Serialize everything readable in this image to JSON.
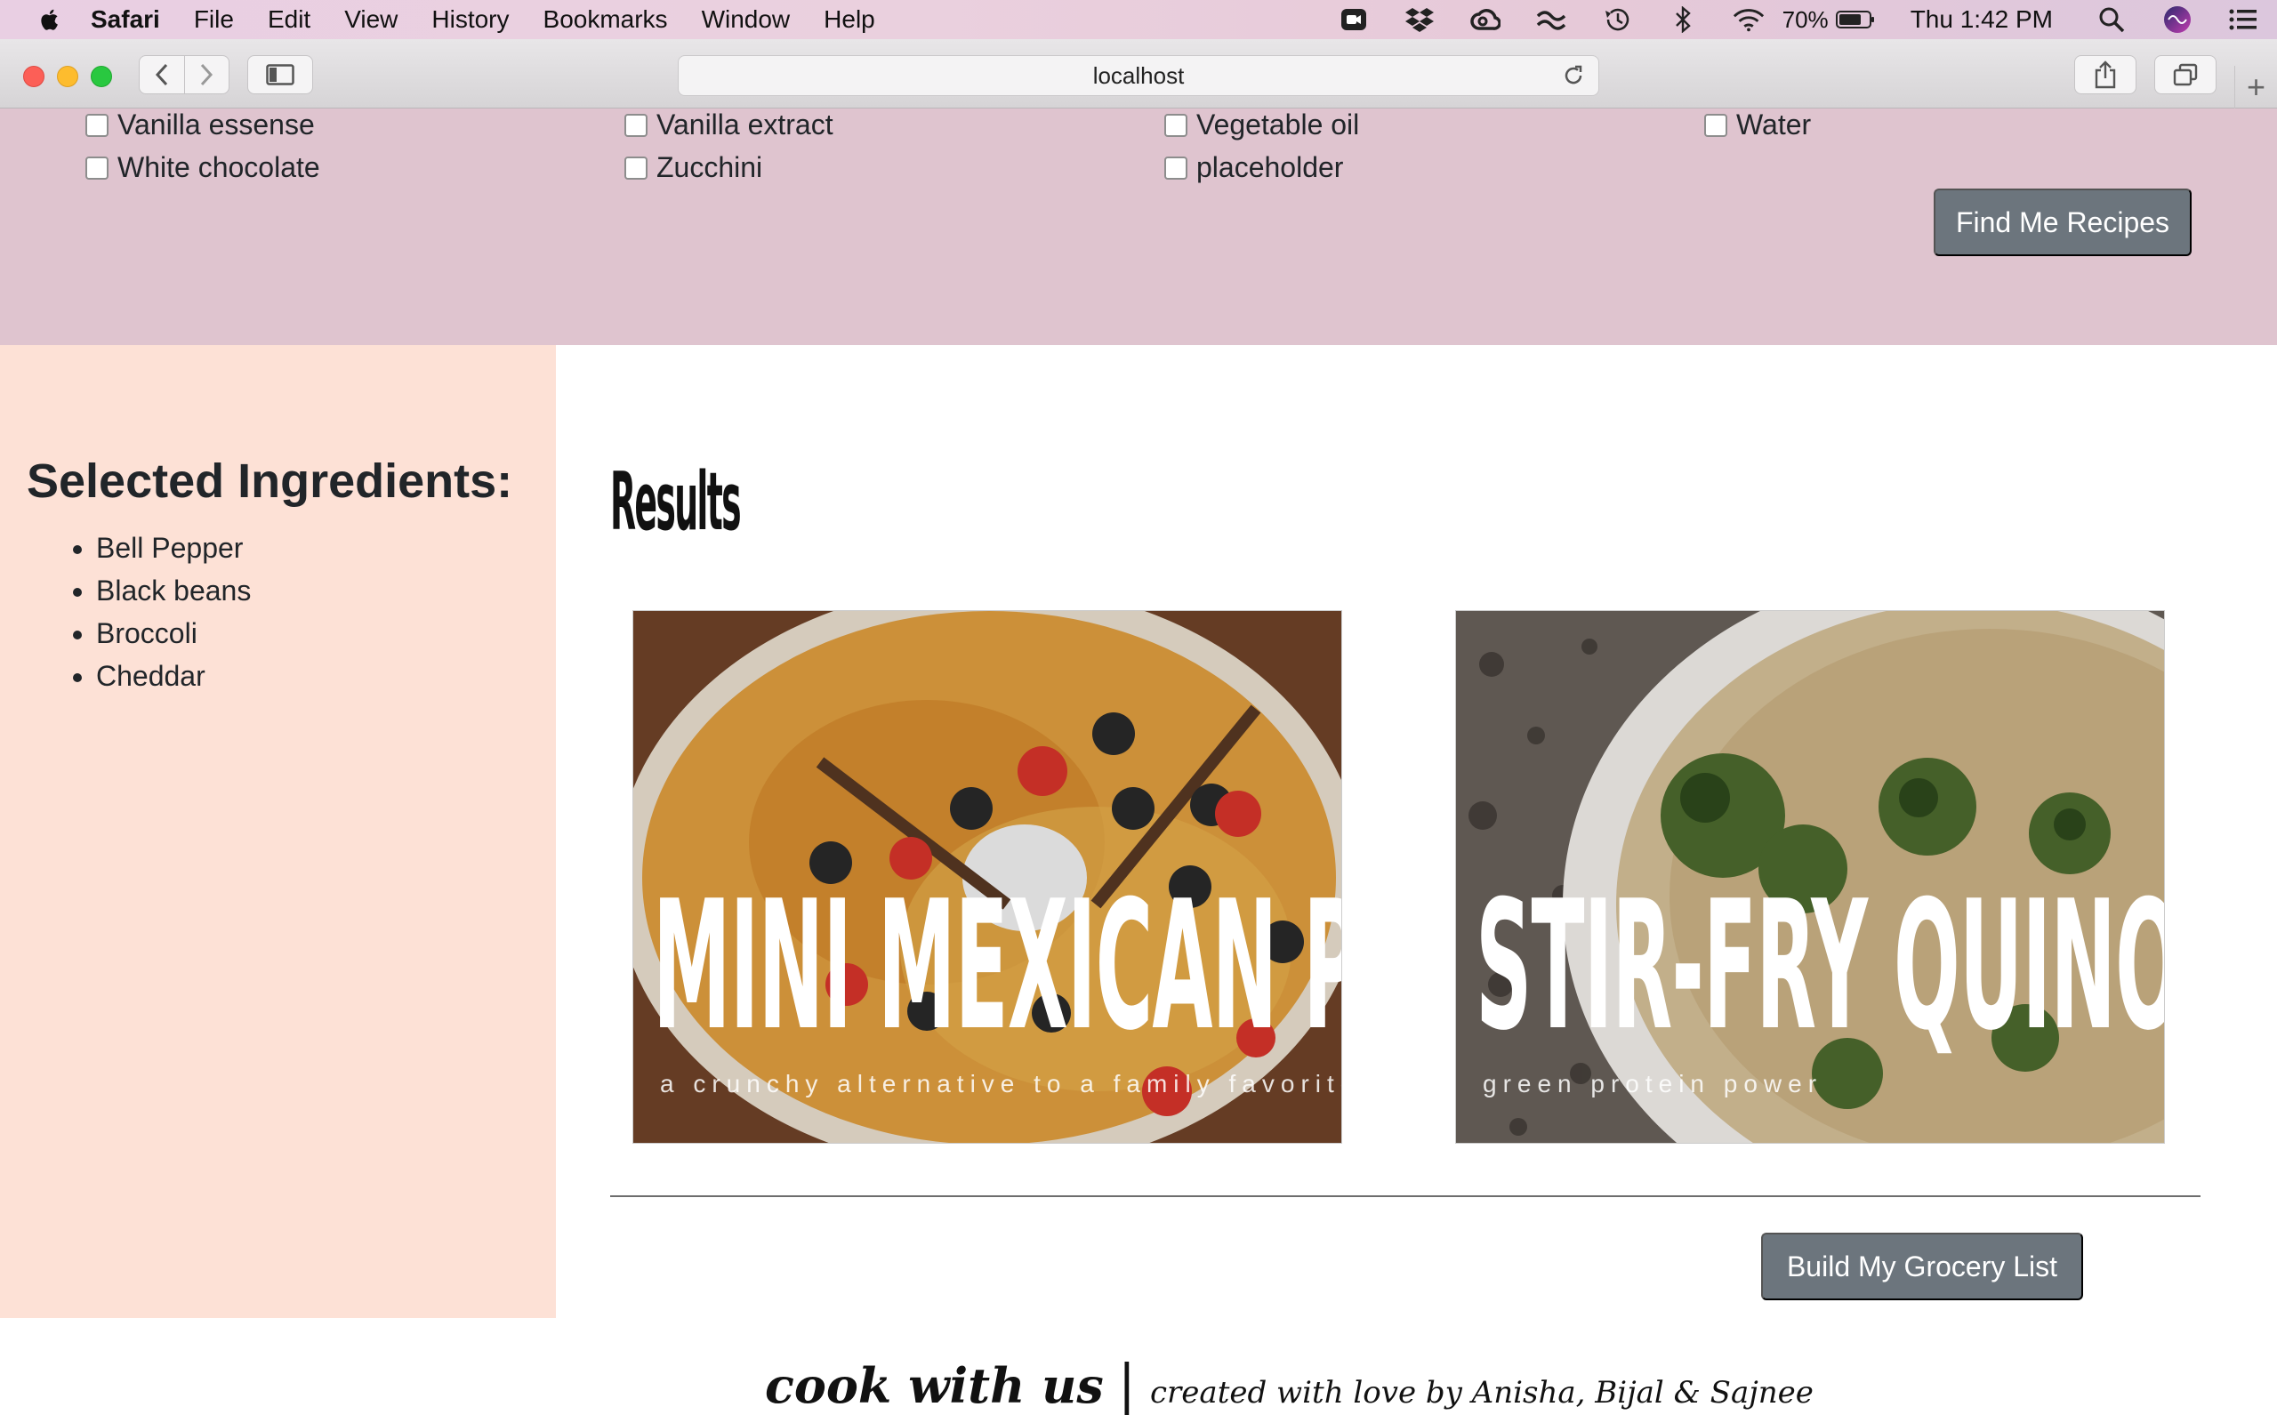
{
  "menubar": {
    "app_name": "Safari",
    "items": [
      "File",
      "Edit",
      "View",
      "History",
      "Bookmarks",
      "Window",
      "Help"
    ],
    "battery": "70%",
    "clock": "Thu 1:42 PM"
  },
  "browser": {
    "url": "localhost"
  },
  "ingredients": {
    "row1": [
      "Vanilla essense",
      "Vanilla extract",
      "Vegetable oil",
      "Water"
    ],
    "row2": [
      "White chocolate",
      "Zucchini",
      "placeholder"
    ],
    "find_button": "Find Me Recipes"
  },
  "selected": {
    "title": "Selected Ingredients:",
    "items": [
      "Bell Pepper",
      "Black beans",
      "Broccoli",
      "Cheddar"
    ]
  },
  "results": {
    "title": "Results",
    "cards": [
      {
        "title": "MINI MEXICAN PIZZA",
        "subtitle": "a crunchy alternative to a family favorite"
      },
      {
        "title": "STIR-FRY QUINOA",
        "subtitle": "green protein power"
      }
    ],
    "grocery_button": "Build My Grocery List"
  },
  "footer": {
    "main": "cook with us",
    "separator": "|",
    "credit": "created with love by Anisha, Bijal & Sajnee"
  }
}
